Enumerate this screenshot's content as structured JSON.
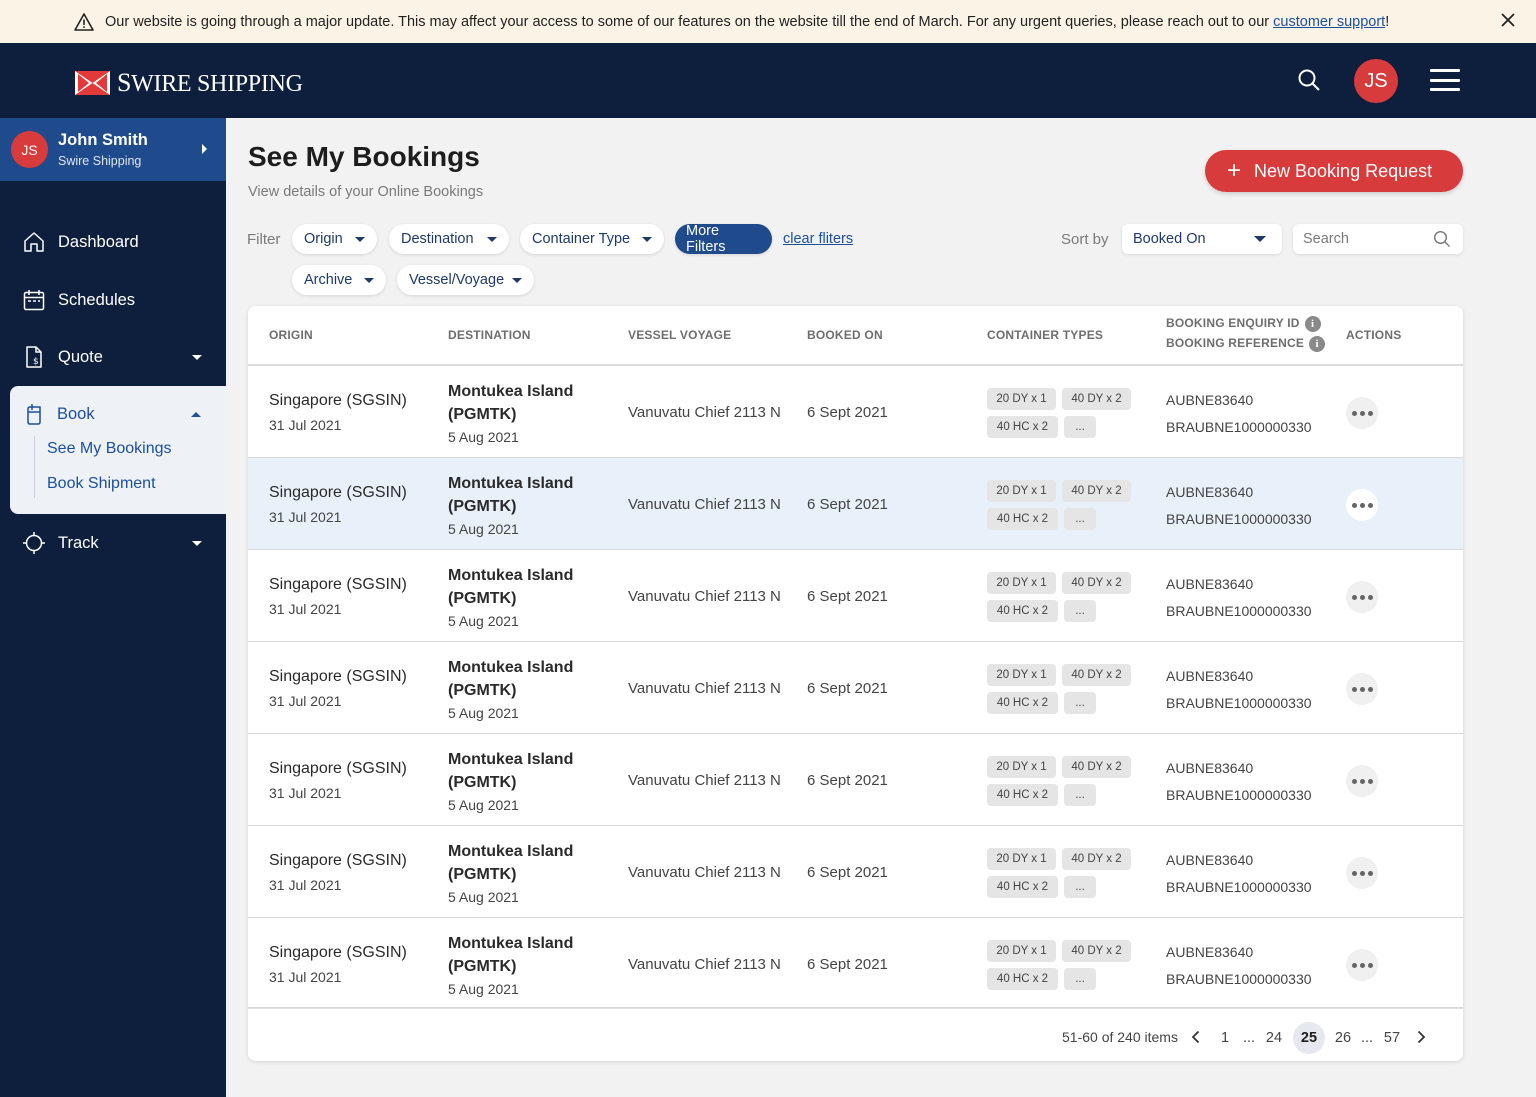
{
  "banner": {
    "message": "Our website is going through a major update. This may affect your access to some of our features on the website till the end of March. For any urgent queries, please reach out to our ",
    "link": "customer support",
    "suffix": "!"
  },
  "header": {
    "brand_initial": "S",
    "brand_rest": "WIRE SHIPPING",
    "user_initials": "JS"
  },
  "user": {
    "initials": "JS",
    "name": "John Smith",
    "company": "Swire Shipping"
  },
  "nav": {
    "dashboard": "Dashboard",
    "schedules": "Schedules",
    "quote": "Quote",
    "book": "Book",
    "book_sub": [
      "See My Bookings",
      "Book Shipment"
    ],
    "track": "Track"
  },
  "page": {
    "title": "See My Bookings",
    "subtitle": "View details of your Online Bookings",
    "new_button": "New Booking Request"
  },
  "filters": {
    "label": "Filter",
    "chips": [
      "Origin",
      "Destination",
      "Container Type",
      "More Filters",
      "Archive",
      "Vessel/Voyage"
    ],
    "clear": "clear fliters",
    "sort_label": "Sort by",
    "sort_value": "Booked On",
    "search_placeholder": "Search"
  },
  "table": {
    "headers": {
      "origin": "ORIGIN",
      "destination": "DESTINATION",
      "vessel": "VESSEL VOYAGE",
      "booked": "BOOKED ON",
      "container": "CONTAINER TYPES",
      "enquiry": "BOOKING ENQUIRY ID",
      "reference": "BOOKING REFERENCE",
      "actions": "ACTIONS"
    },
    "rows": [
      {
        "origin": "Singapore (SGSIN)",
        "origin_date": "31 Jul 2021",
        "destination": "Montukea Island (PGMTK)",
        "dest_date": "5 Aug 2021",
        "vessel": "Vanuvatu Chief 2113 N",
        "booked": "6 Sept 2021",
        "c1": "20 DY x 1",
        "c2": "40 DY x 2",
        "c3": "40 HC x 2",
        "c4": "...",
        "enquiry": "AUBNE83640",
        "reference": "BRAUBNE1000000330"
      },
      {
        "origin": "Singapore (SGSIN)",
        "origin_date": "31 Jul 2021",
        "destination": "Montukea Island (PGMTK)",
        "dest_date": "5 Aug 2021",
        "vessel": "Vanuvatu Chief 2113 N",
        "booked": "6 Sept 2021",
        "c1": "20 DY x 1",
        "c2": "40 DY x 2",
        "c3": "40 HC x 2",
        "c4": "...",
        "enquiry": "AUBNE83640",
        "reference": "BRAUBNE1000000330"
      },
      {
        "origin": "Singapore (SGSIN)",
        "origin_date": "31 Jul 2021",
        "destination": "Montukea Island (PGMTK)",
        "dest_date": "5 Aug 2021",
        "vessel": "Vanuvatu Chief 2113 N",
        "booked": "6 Sept 2021",
        "c1": "20 DY x 1",
        "c2": "40 DY x 2",
        "c3": "40 HC x 2",
        "c4": "...",
        "enquiry": "AUBNE83640",
        "reference": "BRAUBNE1000000330"
      },
      {
        "origin": "Singapore (SGSIN)",
        "origin_date": "31 Jul 2021",
        "destination": "Montukea Island (PGMTK)",
        "dest_date": "5 Aug 2021",
        "vessel": "Vanuvatu Chief 2113 N",
        "booked": "6 Sept 2021",
        "c1": "20 DY x 1",
        "c2": "40 DY x 2",
        "c3": "40 HC x 2",
        "c4": "...",
        "enquiry": "AUBNE83640",
        "reference": "BRAUBNE1000000330"
      },
      {
        "origin": "Singapore (SGSIN)",
        "origin_date": "31 Jul 2021",
        "destination": "Montukea Island (PGMTK)",
        "dest_date": "5 Aug 2021",
        "vessel": "Vanuvatu Chief 2113 N",
        "booked": "6 Sept 2021",
        "c1": "20 DY x 1",
        "c2": "40 DY x 2",
        "c3": "40 HC x 2",
        "c4": "...",
        "enquiry": "AUBNE83640",
        "reference": "BRAUBNE1000000330"
      },
      {
        "origin": "Singapore (SGSIN)",
        "origin_date": "31 Jul 2021",
        "destination": "Montukea Island (PGMTK)",
        "dest_date": "5 Aug 2021",
        "vessel": "Vanuvatu Chief 2113 N",
        "booked": "6 Sept 2021",
        "c1": "20 DY x 1",
        "c2": "40 DY x 2",
        "c3": "40 HC x 2",
        "c4": "...",
        "enquiry": "AUBNE83640",
        "reference": "BRAUBNE1000000330"
      },
      {
        "origin": "Singapore (SGSIN)",
        "origin_date": "31 Jul 2021",
        "destination": "Montukea Island (PGMTK)",
        "dest_date": "5 Aug 2021",
        "vessel": "Vanuvatu Chief 2113 N",
        "booked": "6 Sept 2021",
        "c1": "20 DY x 1",
        "c2": "40 DY x 2",
        "c3": "40 HC x 2",
        "c4": "...",
        "enquiry": "AUBNE83640",
        "reference": "BRAUBNE1000000330"
      }
    ]
  },
  "pagination": {
    "info": "51-60 of 240 items",
    "pages": [
      "1",
      "...",
      "24",
      "25",
      "26",
      "...",
      "57"
    ],
    "current": "25"
  },
  "colors": {
    "navy": "#0e1f3d",
    "accent_red": "#d83b3b",
    "active_blue": "#1f4a8b",
    "link_blue": "#1c4f9c",
    "highlight_row": "#e8f0f9"
  },
  "icons": [
    "warning-icon",
    "close-icon",
    "search-icon",
    "hamburger-icon",
    "home-icon",
    "calendar-icon",
    "quote-icon",
    "book-icon",
    "track-icon",
    "info-icon",
    "more-icon",
    "chevron-left-icon",
    "chevron-right-icon"
  ]
}
